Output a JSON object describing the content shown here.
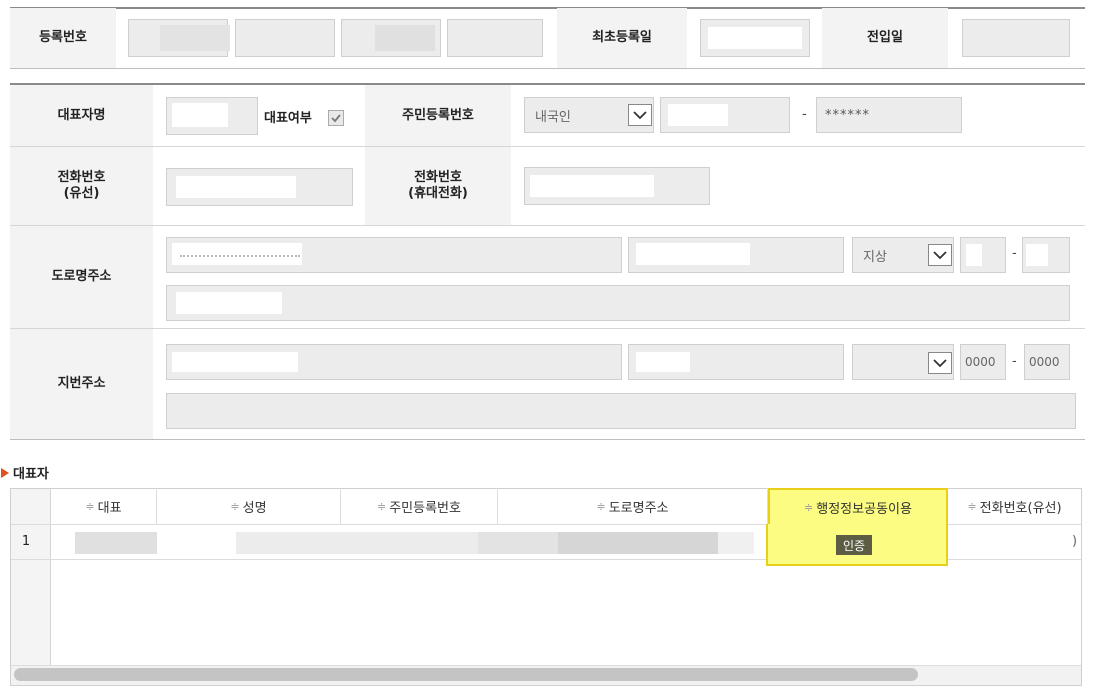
{
  "form1": {
    "reg_no_label": "등록번호",
    "first_reg_label": "최초등록일",
    "move_in_label": "전입일"
  },
  "form2": {
    "rep_name_label": "대표자명",
    "rep_flag_label": "대표여부",
    "rrn_label": "주민등록번호",
    "nationality": "내국인",
    "rrn_dash": "-",
    "rrn_masked": "******",
    "phone_label": "전화번호\n(유선)",
    "mobile_label": "전화번호\n(휴대전화)",
    "road_addr_label": "도로명주소",
    "ground_select": "지상",
    "road_dash": "-",
    "jibun_addr_label": "지번주소",
    "jibun_no1": "0000",
    "jibun_dash": "-",
    "jibun_no2": "0000"
  },
  "section": {
    "title": "대표자"
  },
  "grid": {
    "headers": [
      "대표",
      "성명",
      "주민등록번호",
      "도로명주소",
      "행정정보공동이용",
      "전화번호(유선)"
    ],
    "rows": [
      {
        "no": "1",
        "auth_button": "인증",
        "trailing": ")"
      }
    ]
  },
  "colors": {
    "highlight": "#fcfc82",
    "highlight_border": "#e8d01a",
    "auth_btn": "#5d5d44",
    "arrow": "#e04f1c"
  }
}
